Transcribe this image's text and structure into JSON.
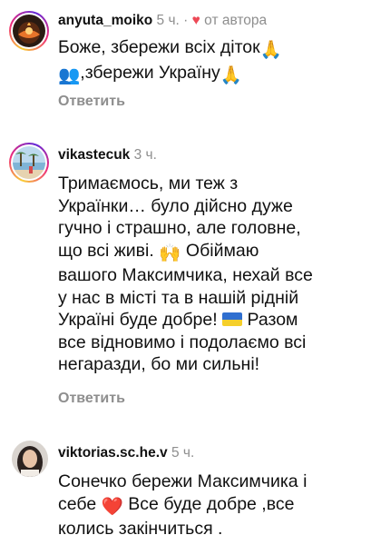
{
  "comments": [
    {
      "username": "anyuta_moiko",
      "time": "5 ч.",
      "dot": "·",
      "author_like_label": "от автора",
      "heart_icon": "heart-icon",
      "lines": [
        "Боже, збережи всіх діток",
        ",збережи Україну"
      ],
      "emoji_pray": "🙏",
      "emoji_children": "👥",
      "reply_label": "Ответить"
    },
    {
      "username": "vikastecuk",
      "time": "3 ч.",
      "lines": [
        "Тримаємось, ми теж з",
        "Українки… було дійсно дуже",
        "гучно і страшно, але головне,",
        "що всі живі.",
        "Обіймаю",
        "вашого Максимчика, нехай все",
        "у нас в місті та в нашій рідній",
        "Україні буде добре!",
        "Разом",
        "все відновимо і подолаємо всі",
        "негаразди, бо ми сильні!"
      ],
      "emoji_hands": "🙌",
      "reply_label": "Ответить"
    },
    {
      "username": "viktorias.sc.he.v",
      "time": "5 ч.",
      "lines": [
        "Сонечко бережи Максимчика і",
        "себе",
        "Все буде добре ,все",
        "колись закінчиться ."
      ],
      "emoji_heart": "❤️"
    }
  ],
  "colors": {
    "meta_gray": "#8e8e8e",
    "heart_red": "#ed4956",
    "text": "#111111"
  }
}
